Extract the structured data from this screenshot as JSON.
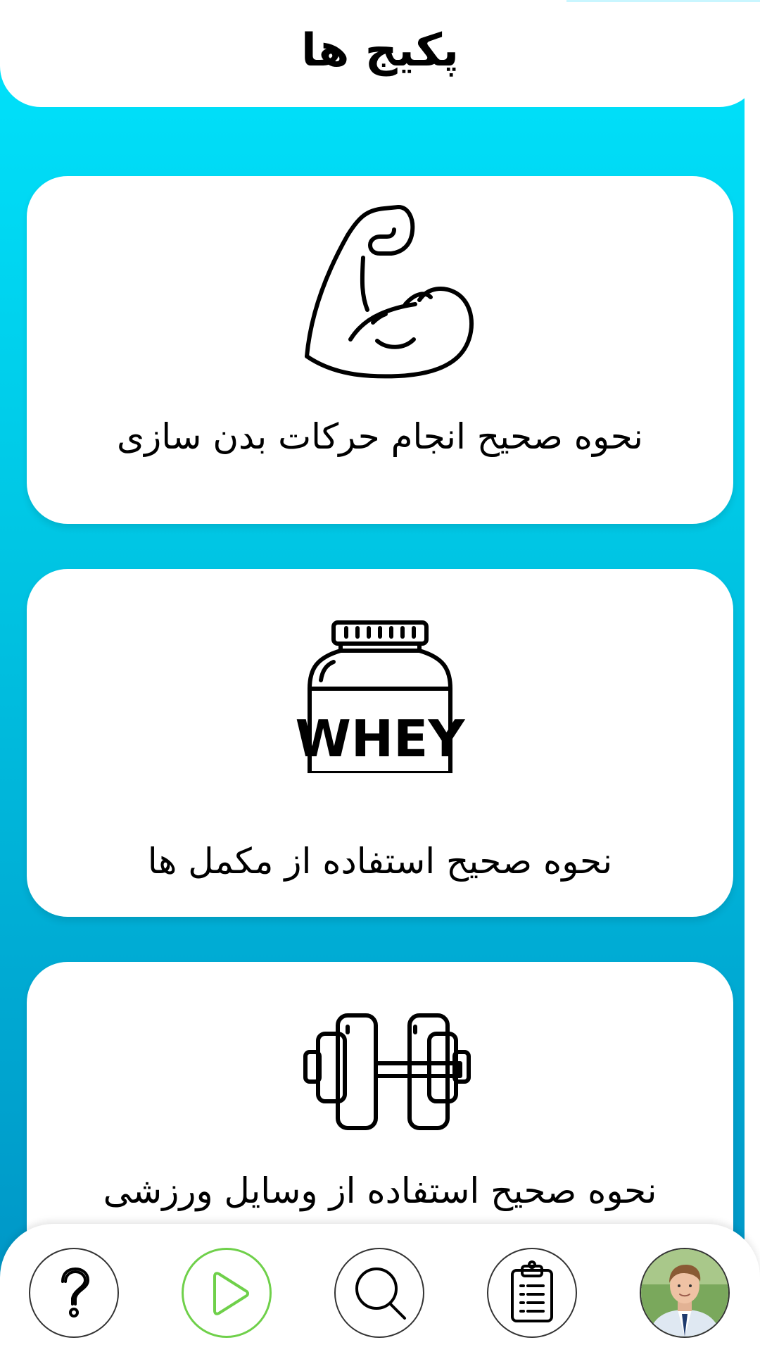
{
  "header": {
    "title": "پکیج ها"
  },
  "packages": [
    {
      "label": "نحوه صحیح انجام حرکات بدن سازی",
      "icon": "flexed-bicep-icon"
    },
    {
      "label": "نحوه صحیح استفاده از مکمل ها",
      "icon": "whey-jar-icon",
      "jar_text": "WHEY"
    },
    {
      "label": "نحوه صحیح استفاده از وسایل ورزشی",
      "icon": "dumbbell-icon"
    }
  ],
  "bottom_nav": {
    "items": [
      {
        "icon": "help-question-icon",
        "active": false
      },
      {
        "icon": "play-icon",
        "active": true
      },
      {
        "icon": "search-icon",
        "active": false
      },
      {
        "icon": "clipboard-icon",
        "active": false
      },
      {
        "icon": "user-avatar",
        "active": false
      }
    ],
    "active_color": "#6fd04a"
  },
  "colors": {
    "gradient_top": "#00e4fd",
    "gradient_bottom": "#0092c4",
    "card_background": "#ffffff"
  }
}
